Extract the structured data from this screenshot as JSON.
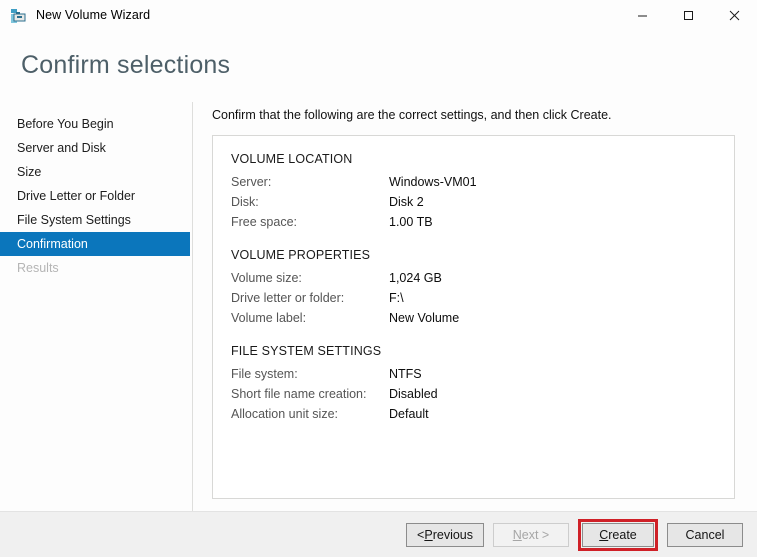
{
  "window": {
    "title": "New Volume Wizard",
    "icon": "volume-wizard-icon",
    "controls": {
      "minimize": "minimize-icon",
      "maximize": "maximize-icon",
      "close": "close-icon"
    }
  },
  "page": {
    "heading": "Confirm selections",
    "instruction": "Confirm that the following are the correct settings, and then click Create."
  },
  "sidebar": {
    "items": [
      {
        "label": "Before You Begin",
        "state": "normal"
      },
      {
        "label": "Server and Disk",
        "state": "normal"
      },
      {
        "label": "Size",
        "state": "normal"
      },
      {
        "label": "Drive Letter or Folder",
        "state": "normal"
      },
      {
        "label": "File System Settings",
        "state": "normal"
      },
      {
        "label": "Confirmation",
        "state": "active"
      },
      {
        "label": "Results",
        "state": "disabled"
      }
    ]
  },
  "summary": {
    "sections": [
      {
        "title": "VOLUME LOCATION",
        "rows": [
          {
            "key": "Server:",
            "value": "Windows-VM01"
          },
          {
            "key": "Disk:",
            "value": "Disk 2"
          },
          {
            "key": "Free space:",
            "value": "1.00 TB"
          }
        ]
      },
      {
        "title": "VOLUME PROPERTIES",
        "rows": [
          {
            "key": "Volume size:",
            "value": "1,024 GB"
          },
          {
            "key": "Drive letter or folder:",
            "value": "F:\\"
          },
          {
            "key": "Volume label:",
            "value": "New Volume"
          }
        ]
      },
      {
        "title": "FILE SYSTEM SETTINGS",
        "rows": [
          {
            "key": "File system:",
            "value": "NTFS"
          },
          {
            "key": "Short file name creation:",
            "value": "Disabled"
          },
          {
            "key": "Allocation unit size:",
            "value": "Default"
          }
        ]
      }
    ]
  },
  "footer": {
    "buttons": [
      {
        "name": "previous-button",
        "prefix": "< ",
        "accel": "P",
        "rest": "revious",
        "suffix": "",
        "state": "normal",
        "highlighted": false
      },
      {
        "name": "next-button",
        "prefix": "",
        "accel": "N",
        "rest": "ext",
        "suffix": " >",
        "state": "disabled",
        "highlighted": false
      },
      {
        "name": "create-button",
        "prefix": "",
        "accel": "C",
        "rest": "reate",
        "suffix": "",
        "state": "normal",
        "highlighted": true
      },
      {
        "name": "cancel-button",
        "prefix": "Cancel",
        "accel": "",
        "rest": "",
        "suffix": "",
        "state": "normal",
        "highlighted": false
      }
    ]
  },
  "colors": {
    "accent": "#0b76bc",
    "heading": "#4d5f68",
    "annotation": "#cf2027",
    "footer_bg": "#f0f0f0"
  }
}
